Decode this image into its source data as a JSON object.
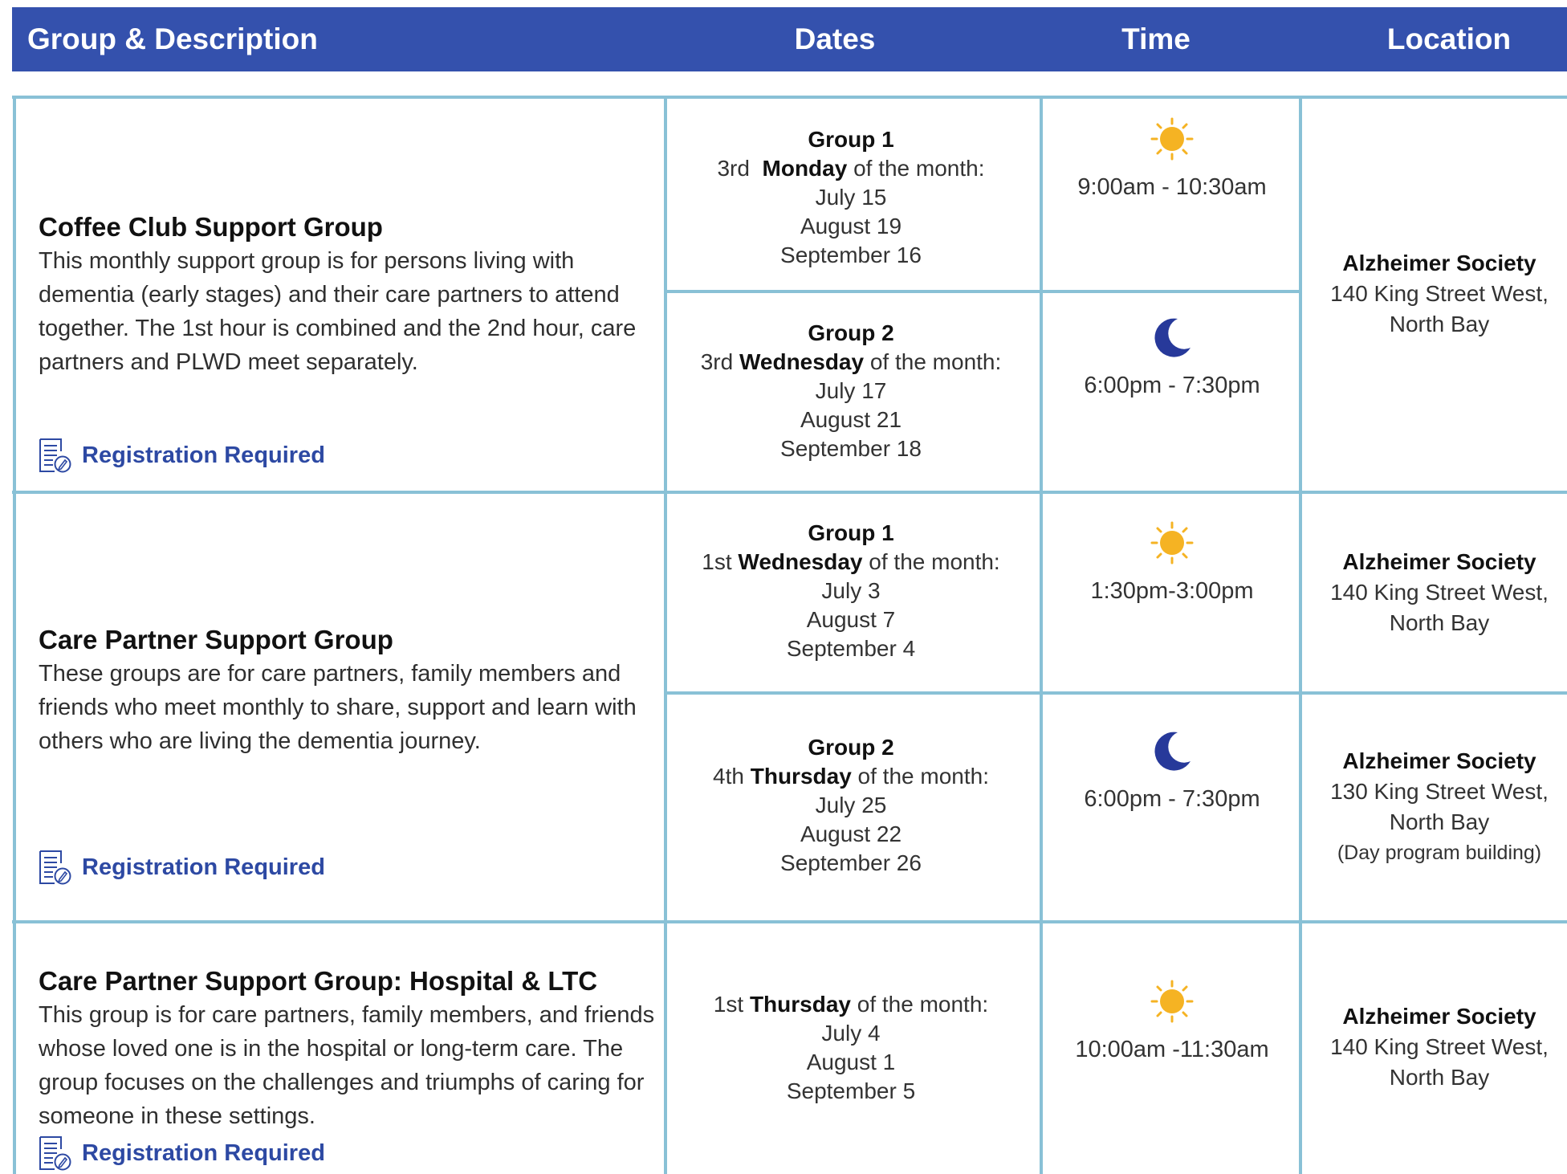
{
  "header": {
    "group_description": "Group & Description",
    "dates": "Dates",
    "time": "Time",
    "location": "Location"
  },
  "rows": [
    {
      "title": "Coffee Club Support Group",
      "description": "This monthly support group is for persons living with dementia (early stages) and their care partners to attend together. The 1st hour is combined and the 2nd hour, care partners and PLWD meet separately.",
      "registration": "Registration Required",
      "sessions": [
        {
          "group": "Group 1",
          "ordinal": "3rd",
          "weekday": "Monday",
          "suffix": "of the month:",
          "dates": [
            "July 15",
            "August 19",
            "September 16"
          ],
          "time_icon": "sun-icon",
          "time": "9:00am - 10:30am"
        },
        {
          "group": "Group 2",
          "ordinal": "3rd",
          "weekday": "Wednesday",
          "suffix": "of the month:",
          "dates": [
            "July 17",
            "August 21",
            "September 18"
          ],
          "time_icon": "moon-icon",
          "time": "6:00pm - 7:30pm"
        }
      ],
      "location": {
        "org": "Alzheimer Society",
        "line1": "140 King Street West,",
        "line2": "North Bay"
      }
    },
    {
      "title": "Care Partner Support Group",
      "description": "These groups are for care partners, family members and friends who meet monthly to share, support and learn with others who are living the dementia journey.",
      "registration": "Registration Required",
      "sessions": [
        {
          "group": "Group 1",
          "ordinal": "1st",
          "weekday": "Wednesday",
          "suffix": "of the month:",
          "dates": [
            "July 3",
            "August 7",
            "September 4"
          ],
          "time_icon": "sun-icon",
          "time": "1:30pm-3:00pm",
          "location": {
            "org": "Alzheimer Society",
            "line1": "140 King Street West,",
            "line2": "North Bay"
          }
        },
        {
          "group": "Group 2",
          "ordinal": "4th",
          "weekday": "Thursday",
          "suffix": "of the month:",
          "dates": [
            "July 25",
            "August 22",
            "September 26"
          ],
          "time_icon": "moon-icon",
          "time": "6:00pm - 7:30pm",
          "location": {
            "org": "Alzheimer Society",
            "line1": "130 King Street West,",
            "line2": "North Bay",
            "note": "(Day program building)"
          }
        }
      ]
    },
    {
      "title": "Care Partner Support Group: Hospital & LTC",
      "description": "This group is for care partners, family members, and friends whose loved one is in the hospital or long-term care. The group focuses on the challenges and triumphs of caring for someone in these settings.",
      "registration": "Registration Required",
      "sessions": [
        {
          "ordinal": "1st",
          "weekday": "Thursday",
          "suffix": "of the month:",
          "dates": [
            "July 4",
            "August 1",
            "September 5"
          ],
          "time_icon": "sun-icon",
          "time": "10:00am -11:30am"
        }
      ],
      "location": {
        "org": "Alzheimer Society",
        "line1": "140 King Street West,",
        "line2": "North Bay"
      }
    }
  ],
  "colors": {
    "header_bg": "#3451ad",
    "grid_line": "#89c1d6",
    "link_blue": "#2d49a3",
    "sun": "#f5b323",
    "moon": "#27399a"
  }
}
